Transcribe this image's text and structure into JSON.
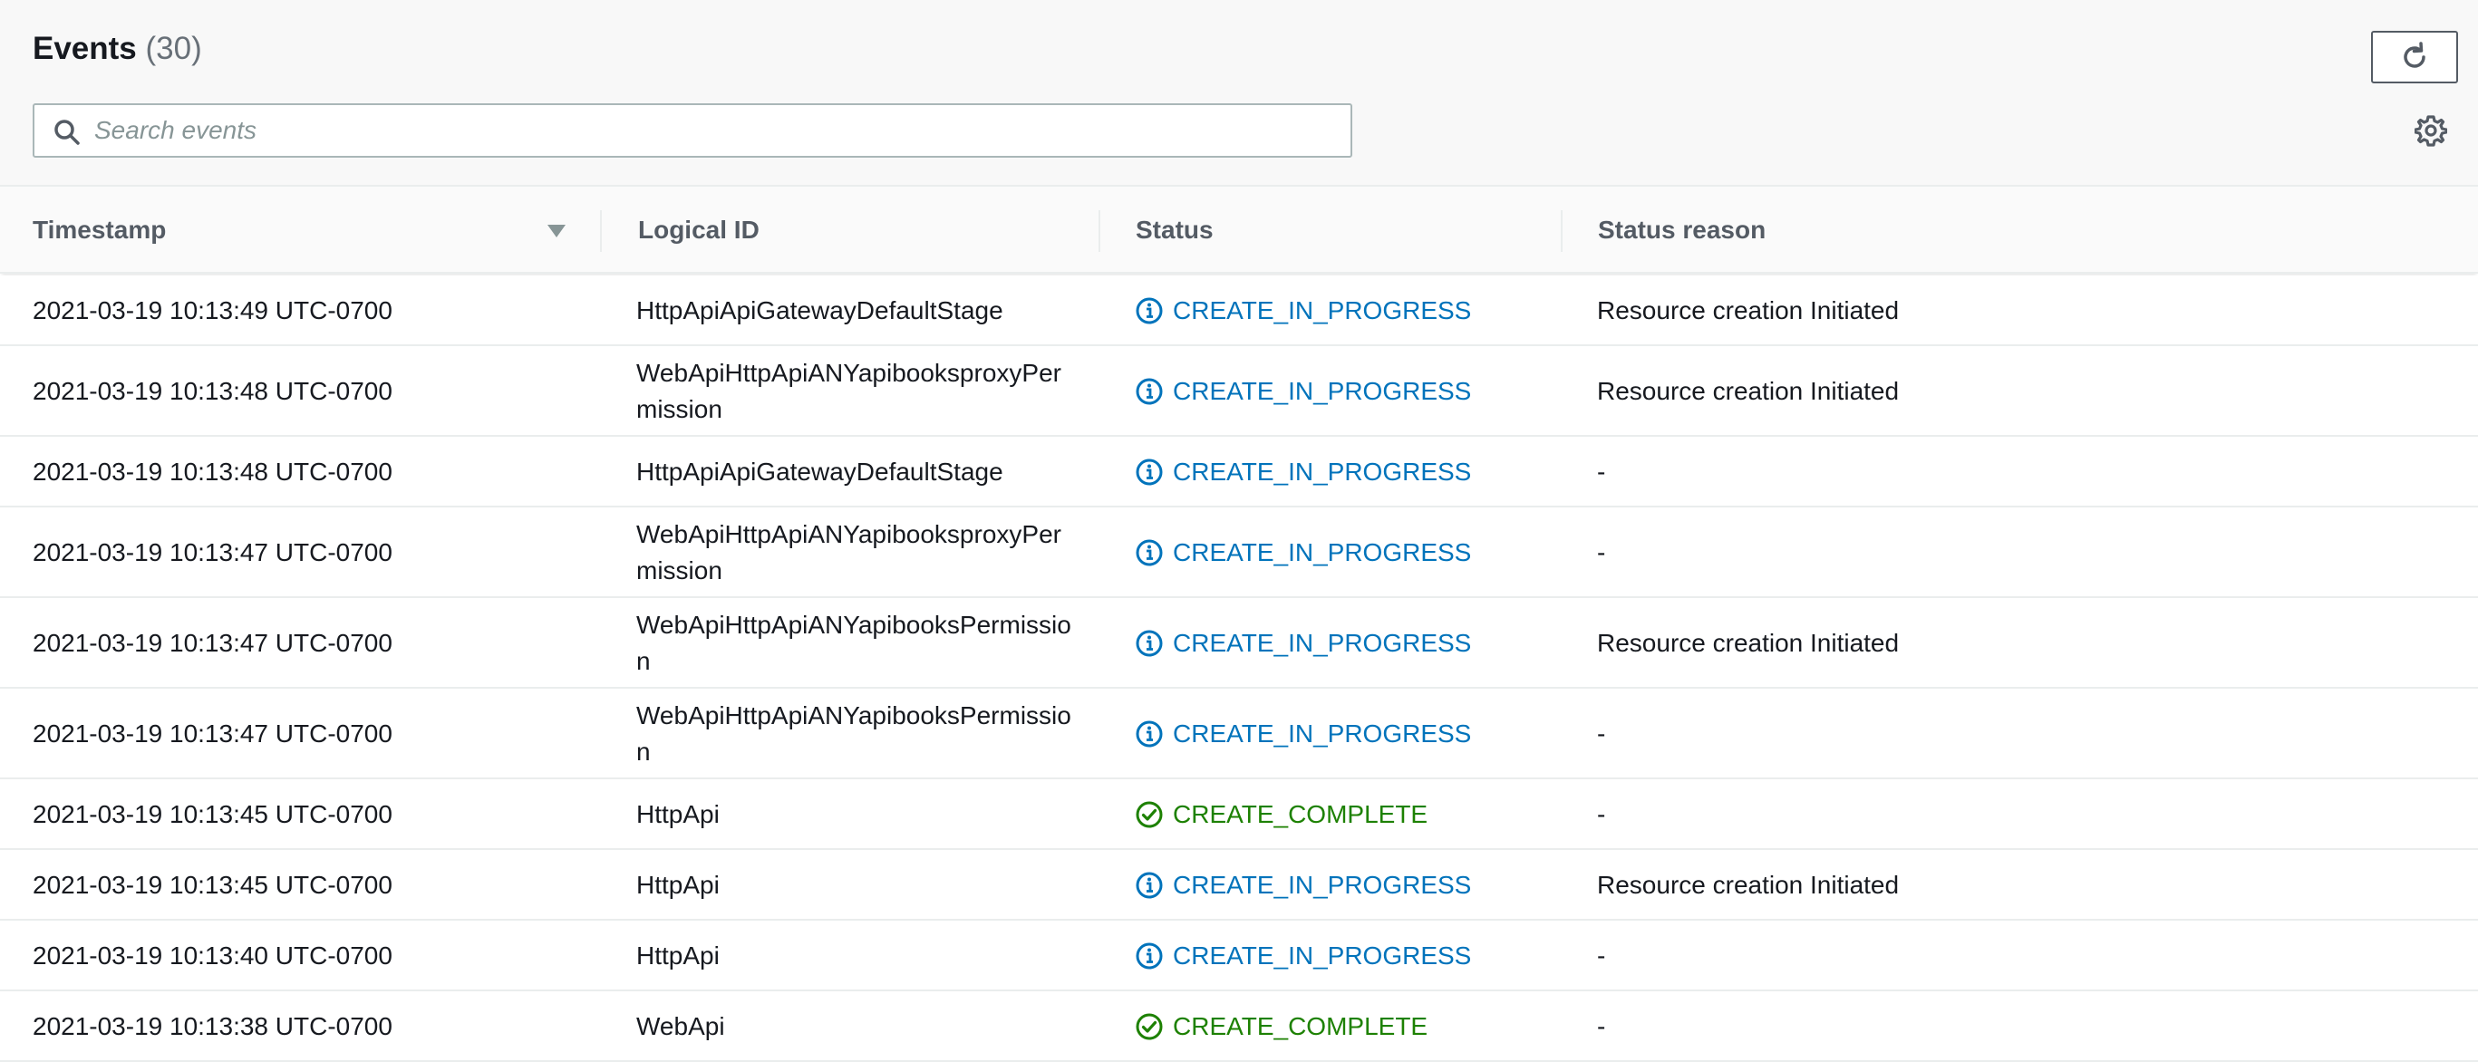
{
  "header": {
    "title": "Events",
    "count": "(30)",
    "search_placeholder": "Search events"
  },
  "columns": {
    "timestamp": "Timestamp",
    "logical_id": "Logical ID",
    "status": "Status",
    "status_reason": "Status reason"
  },
  "rows": [
    {
      "timestamp": "2021-03-19 10:13:49 UTC-0700",
      "logical_id": "HttpApiApiGatewayDefaultStage",
      "status": "CREATE_IN_PROGRESS",
      "status_type": "info",
      "reason": "Resource creation Initiated"
    },
    {
      "timestamp": "2021-03-19 10:13:48 UTC-0700",
      "logical_id": "WebApiHttpApiANYapibooksproxyPermission",
      "status": "CREATE_IN_PROGRESS",
      "status_type": "info",
      "reason": "Resource creation Initiated"
    },
    {
      "timestamp": "2021-03-19 10:13:48 UTC-0700",
      "logical_id": "HttpApiApiGatewayDefaultStage",
      "status": "CREATE_IN_PROGRESS",
      "status_type": "info",
      "reason": "-"
    },
    {
      "timestamp": "2021-03-19 10:13:47 UTC-0700",
      "logical_id": "WebApiHttpApiANYapibooksproxyPermission",
      "status": "CREATE_IN_PROGRESS",
      "status_type": "info",
      "reason": "-"
    },
    {
      "timestamp": "2021-03-19 10:13:47 UTC-0700",
      "logical_id": "WebApiHttpApiANYapibooksPermission",
      "status": "CREATE_IN_PROGRESS",
      "status_type": "info",
      "reason": "Resource creation Initiated"
    },
    {
      "timestamp": "2021-03-19 10:13:47 UTC-0700",
      "logical_id": "WebApiHttpApiANYapibooksPermission",
      "status": "CREATE_IN_PROGRESS",
      "status_type": "info",
      "reason": "-"
    },
    {
      "timestamp": "2021-03-19 10:13:45 UTC-0700",
      "logical_id": "HttpApi",
      "status": "CREATE_COMPLETE",
      "status_type": "success",
      "reason": "-"
    },
    {
      "timestamp": "2021-03-19 10:13:45 UTC-0700",
      "logical_id": "HttpApi",
      "status": "CREATE_IN_PROGRESS",
      "status_type": "info",
      "reason": "Resource creation Initiated"
    },
    {
      "timestamp": "2021-03-19 10:13:40 UTC-0700",
      "logical_id": "HttpApi",
      "status": "CREATE_IN_PROGRESS",
      "status_type": "info",
      "reason": "-"
    },
    {
      "timestamp": "2021-03-19 10:13:38 UTC-0700",
      "logical_id": "WebApi",
      "status": "CREATE_COMPLETE",
      "status_type": "success",
      "reason": "-"
    }
  ],
  "colors": {
    "info": "#0073bb",
    "success": "#1d8102"
  },
  "icons": {
    "refresh": "refresh-icon",
    "settings": "gear-icon",
    "search": "search-icon",
    "sort": "sort-descending-icon",
    "info": "info-icon",
    "success": "check-circle-icon"
  }
}
